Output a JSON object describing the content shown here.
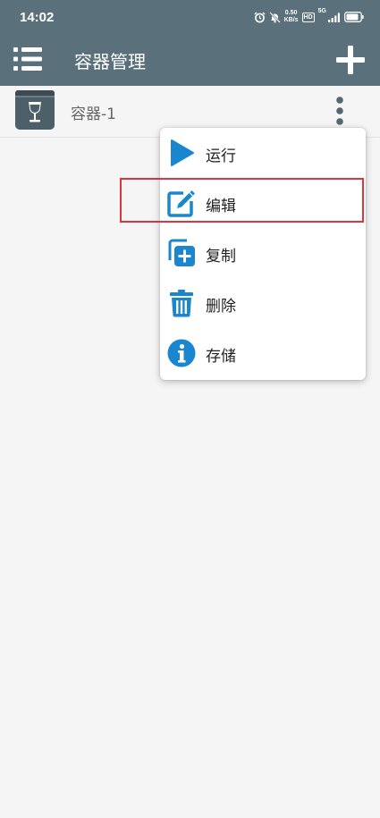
{
  "status_bar": {
    "time": "14:02",
    "net_speed_value": "0.50",
    "net_speed_unit": "KB/s",
    "hd_label": "HD",
    "signal_label": "5G",
    "icons": [
      "alarm-icon",
      "mute-icon",
      "signal-icon",
      "battery-icon"
    ]
  },
  "app_bar": {
    "title": "容器管理",
    "menu_icon": "list-menu-icon",
    "add_icon": "plus-icon"
  },
  "containers": [
    {
      "name": "容器-1",
      "icon": "wine-glass-box-icon"
    }
  ],
  "popup_menu": {
    "items": [
      {
        "label": "运行",
        "icon": "play-icon"
      },
      {
        "label": "编辑",
        "icon": "edit-icon",
        "highlighted": true
      },
      {
        "label": "复制",
        "icon": "copy-icon"
      },
      {
        "label": "删除",
        "icon": "trash-icon"
      },
      {
        "label": "存储",
        "icon": "info-icon"
      }
    ]
  },
  "colors": {
    "app_bar": "#5a707b",
    "icon_blue": "#1a86d0",
    "highlight": "#d9363e",
    "background": "#f5f5f5"
  }
}
